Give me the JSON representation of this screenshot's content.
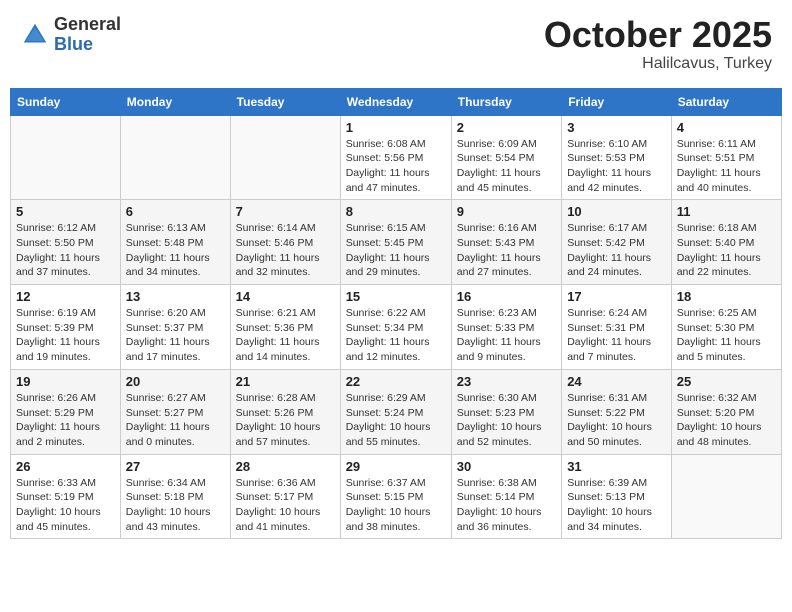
{
  "header": {
    "logo_line1": "General",
    "logo_line2": "Blue",
    "month": "October 2025",
    "location": "Halilcavus, Turkey"
  },
  "weekdays": [
    "Sunday",
    "Monday",
    "Tuesday",
    "Wednesday",
    "Thursday",
    "Friday",
    "Saturday"
  ],
  "weeks": [
    [
      {
        "day": "",
        "info": ""
      },
      {
        "day": "",
        "info": ""
      },
      {
        "day": "",
        "info": ""
      },
      {
        "day": "1",
        "info": "Sunrise: 6:08 AM\nSunset: 5:56 PM\nDaylight: 11 hours and 47 minutes."
      },
      {
        "day": "2",
        "info": "Sunrise: 6:09 AM\nSunset: 5:54 PM\nDaylight: 11 hours and 45 minutes."
      },
      {
        "day": "3",
        "info": "Sunrise: 6:10 AM\nSunset: 5:53 PM\nDaylight: 11 hours and 42 minutes."
      },
      {
        "day": "4",
        "info": "Sunrise: 6:11 AM\nSunset: 5:51 PM\nDaylight: 11 hours and 40 minutes."
      }
    ],
    [
      {
        "day": "5",
        "info": "Sunrise: 6:12 AM\nSunset: 5:50 PM\nDaylight: 11 hours and 37 minutes."
      },
      {
        "day": "6",
        "info": "Sunrise: 6:13 AM\nSunset: 5:48 PM\nDaylight: 11 hours and 34 minutes."
      },
      {
        "day": "7",
        "info": "Sunrise: 6:14 AM\nSunset: 5:46 PM\nDaylight: 11 hours and 32 minutes."
      },
      {
        "day": "8",
        "info": "Sunrise: 6:15 AM\nSunset: 5:45 PM\nDaylight: 11 hours and 29 minutes."
      },
      {
        "day": "9",
        "info": "Sunrise: 6:16 AM\nSunset: 5:43 PM\nDaylight: 11 hours and 27 minutes."
      },
      {
        "day": "10",
        "info": "Sunrise: 6:17 AM\nSunset: 5:42 PM\nDaylight: 11 hours and 24 minutes."
      },
      {
        "day": "11",
        "info": "Sunrise: 6:18 AM\nSunset: 5:40 PM\nDaylight: 11 hours and 22 minutes."
      }
    ],
    [
      {
        "day": "12",
        "info": "Sunrise: 6:19 AM\nSunset: 5:39 PM\nDaylight: 11 hours and 19 minutes."
      },
      {
        "day": "13",
        "info": "Sunrise: 6:20 AM\nSunset: 5:37 PM\nDaylight: 11 hours and 17 minutes."
      },
      {
        "day": "14",
        "info": "Sunrise: 6:21 AM\nSunset: 5:36 PM\nDaylight: 11 hours and 14 minutes."
      },
      {
        "day": "15",
        "info": "Sunrise: 6:22 AM\nSunset: 5:34 PM\nDaylight: 11 hours and 12 minutes."
      },
      {
        "day": "16",
        "info": "Sunrise: 6:23 AM\nSunset: 5:33 PM\nDaylight: 11 hours and 9 minutes."
      },
      {
        "day": "17",
        "info": "Sunrise: 6:24 AM\nSunset: 5:31 PM\nDaylight: 11 hours and 7 minutes."
      },
      {
        "day": "18",
        "info": "Sunrise: 6:25 AM\nSunset: 5:30 PM\nDaylight: 11 hours and 5 minutes."
      }
    ],
    [
      {
        "day": "19",
        "info": "Sunrise: 6:26 AM\nSunset: 5:29 PM\nDaylight: 11 hours and 2 minutes."
      },
      {
        "day": "20",
        "info": "Sunrise: 6:27 AM\nSunset: 5:27 PM\nDaylight: 11 hours and 0 minutes."
      },
      {
        "day": "21",
        "info": "Sunrise: 6:28 AM\nSunset: 5:26 PM\nDaylight: 10 hours and 57 minutes."
      },
      {
        "day": "22",
        "info": "Sunrise: 6:29 AM\nSunset: 5:24 PM\nDaylight: 10 hours and 55 minutes."
      },
      {
        "day": "23",
        "info": "Sunrise: 6:30 AM\nSunset: 5:23 PM\nDaylight: 10 hours and 52 minutes."
      },
      {
        "day": "24",
        "info": "Sunrise: 6:31 AM\nSunset: 5:22 PM\nDaylight: 10 hours and 50 minutes."
      },
      {
        "day": "25",
        "info": "Sunrise: 6:32 AM\nSunset: 5:20 PM\nDaylight: 10 hours and 48 minutes."
      }
    ],
    [
      {
        "day": "26",
        "info": "Sunrise: 6:33 AM\nSunset: 5:19 PM\nDaylight: 10 hours and 45 minutes."
      },
      {
        "day": "27",
        "info": "Sunrise: 6:34 AM\nSunset: 5:18 PM\nDaylight: 10 hours and 43 minutes."
      },
      {
        "day": "28",
        "info": "Sunrise: 6:36 AM\nSunset: 5:17 PM\nDaylight: 10 hours and 41 minutes."
      },
      {
        "day": "29",
        "info": "Sunrise: 6:37 AM\nSunset: 5:15 PM\nDaylight: 10 hours and 38 minutes."
      },
      {
        "day": "30",
        "info": "Sunrise: 6:38 AM\nSunset: 5:14 PM\nDaylight: 10 hours and 36 minutes."
      },
      {
        "day": "31",
        "info": "Sunrise: 6:39 AM\nSunset: 5:13 PM\nDaylight: 10 hours and 34 minutes."
      },
      {
        "day": "",
        "info": ""
      }
    ]
  ]
}
